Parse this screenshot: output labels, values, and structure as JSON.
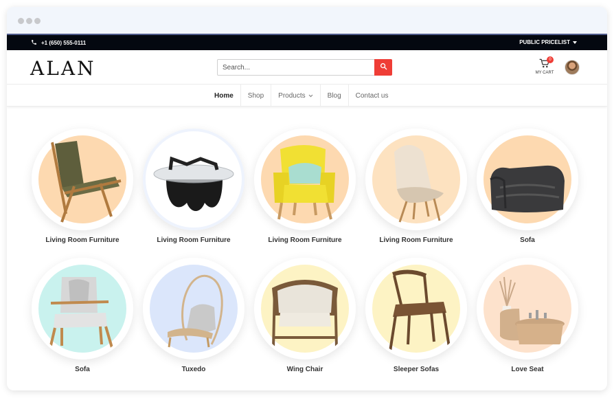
{
  "window": {
    "controls": [
      "close-dot",
      "minimize-dot",
      "maximize-dot"
    ]
  },
  "topbar": {
    "phone": "+1 (650) 555-0111",
    "pricelist": "PUBLIC PRICELIST"
  },
  "header": {
    "logo": "ALAN",
    "search_placeholder": "Search...",
    "cart_label": "MY CART",
    "cart_count": "0",
    "icons": [
      "phone-icon",
      "caret-down-icon",
      "search-icon",
      "cart-icon",
      "user-avatar"
    ]
  },
  "nav": {
    "items": [
      {
        "label": "Home",
        "active": true
      },
      {
        "label": "Shop"
      },
      {
        "label": "Products",
        "dropdown": true
      },
      {
        "label": "Blog"
      },
      {
        "label": "Contact us"
      }
    ]
  },
  "categories": [
    {
      "label": "Living Room Furniture",
      "bg": "#fdd9b0"
    },
    {
      "label": "Living Room Furniture",
      "bg": "#ffffff"
    },
    {
      "label": "Living Room Furniture",
      "bg": "#fdd9b0"
    },
    {
      "label": "Living Room Furniture",
      "bg": "#fde2c0"
    },
    {
      "label": "Sofa",
      "bg": "#fdd9b0"
    },
    {
      "label": "Sofa",
      "bg": "#c9f2ee"
    },
    {
      "label": "Tuxedo",
      "bg": "#dbe6fb"
    },
    {
      "label": "Wing Chair",
      "bg": "#fdf3c4"
    },
    {
      "label": "Sleeper Sofas",
      "bg": "#fdf3c4"
    },
    {
      "label": "Love Seat",
      "bg": "#fde2cc"
    }
  ],
  "colors": {
    "accent": "#ef3d36",
    "topbar": "#040810",
    "chrome": "#f2f6fc"
  }
}
